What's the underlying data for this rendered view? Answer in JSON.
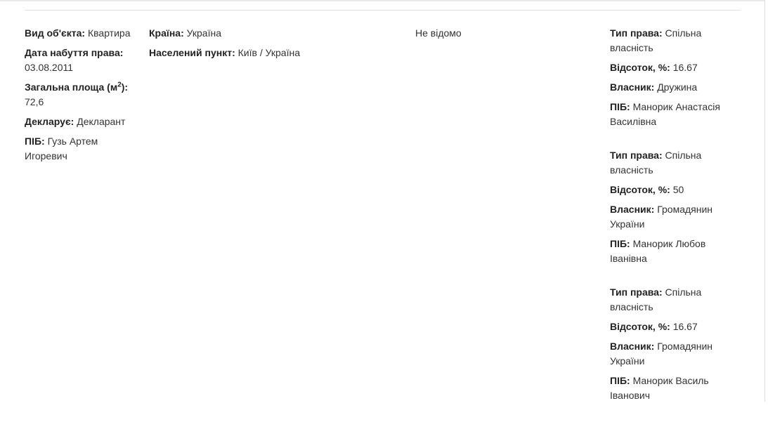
{
  "property": {
    "object_type_label": "Вид об'єкта:",
    "object_type_value": "Квартира",
    "acquired_label": "Дата набуття права:",
    "acquired_value": "03.08.2011",
    "area_label_pre": "Загальна площа (м",
    "area_label_sup": "2",
    "area_label_post": "):",
    "area_value": "72,6",
    "declares_label": "Декларує:",
    "declares_value": "Декларант",
    "name_label": "ПІБ:",
    "name_value": "Гузь Артем Игоревич"
  },
  "location": {
    "country_label": "Країна:",
    "country_value": "Україна",
    "city_label": "Населений пункт:",
    "city_value": "Київ / Україна"
  },
  "cost": {
    "value": "Не відомо"
  },
  "rights": [
    {
      "type_label": "Тип права:",
      "type_value": "Спільна власність",
      "share_label": "Відсоток, %:",
      "share_value": "16.67",
      "owner_label": "Власник:",
      "owner_value": "Дружина",
      "name_label": "ПІБ:",
      "name_value": "Манорик Анастасія Василівна"
    },
    {
      "type_label": "Тип права:",
      "type_value": "Спільна власність",
      "share_label": "Відсоток, %:",
      "share_value": "50",
      "owner_label": "Власник:",
      "owner_value": "Громадянин України",
      "name_label": "ПІБ:",
      "name_value": "Манорик Любов Іванівна"
    },
    {
      "type_label": "Тип права:",
      "type_value": "Спільна власність",
      "share_label": "Відсоток, %:",
      "share_value": "16.67",
      "owner_label": "Власник:",
      "owner_value": "Громадянин України",
      "name_label": "ПІБ:",
      "name_value": "Манорик Василь Іванович"
    }
  ]
}
